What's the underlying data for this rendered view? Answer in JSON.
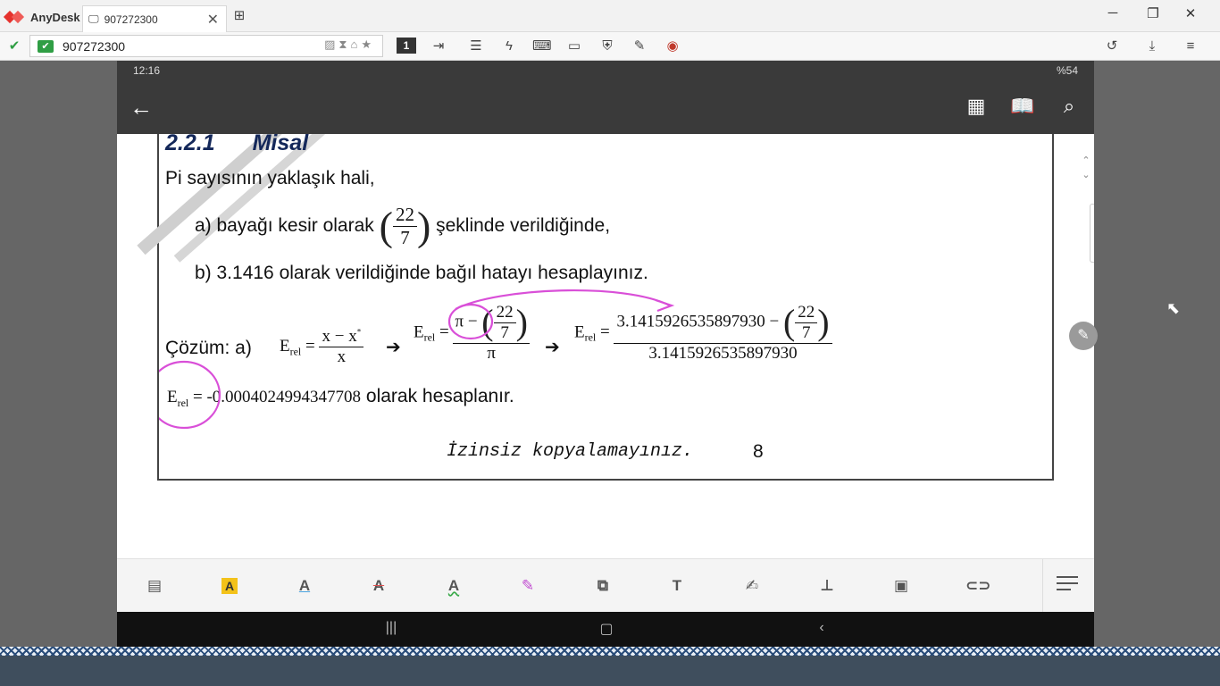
{
  "app": {
    "brand": "AnyDesk"
  },
  "tab": {
    "label": "907272300",
    "close": "✕"
  },
  "window_controls": {
    "minimize": "─",
    "restore": "❐",
    "close": "✕"
  },
  "address": {
    "value": "907272300"
  },
  "toolbar": {
    "display_badge": "1"
  },
  "status_bar": {
    "time": "12:16",
    "battery": "%54"
  },
  "document": {
    "section_number": "2.2.1",
    "section_title": "Misal",
    "intro": "Pi sayısının yaklaşık hali,",
    "item_a_prefix": "a) bayağı kesir olarak",
    "frac_num": "22",
    "frac_den": "7",
    "item_a_suffix": "şeklinde verildiğinde,",
    "item_b": "b) 3.1416 olarak verildiğinde bağıl hatayı hesaplayınız.",
    "solution_label": "Çözüm: a)",
    "erel": "E",
    "erel_sub": "rel",
    "x_num": "x − x",
    "x_star": "*",
    "x_den": "x",
    "pi": "π",
    "pi_value": "3.1415926535897930",
    "arrow": "➔",
    "result_value": "-0.0004024994347708",
    "result_suffix": "olarak hesaplanır.",
    "footer_text": "İzinsiz kopyalamayınız.",
    "page_number": "8"
  },
  "colors": {
    "annotation_ink": "#d94fd8",
    "highlight": "#f3c21a",
    "heading": "#14285a"
  }
}
